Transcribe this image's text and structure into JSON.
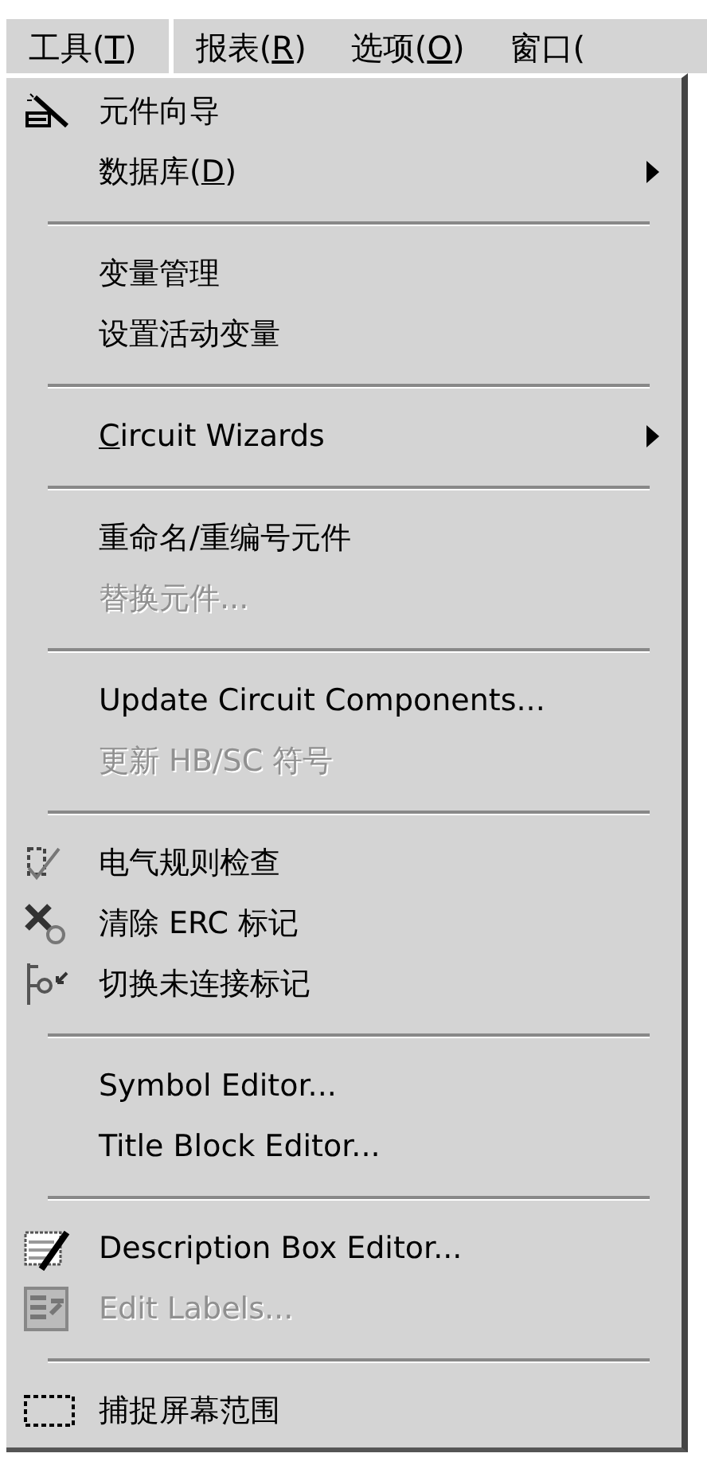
{
  "menu_bar": [
    {
      "before": "工具(",
      "key": "T",
      "after": ")",
      "selected": true
    },
    {
      "before": "报表(",
      "key": "R",
      "after": ")",
      "selected": false
    },
    {
      "before": "选项(",
      "key": "O",
      "after": ")",
      "selected": false
    },
    {
      "before": "窗口(",
      "selected": false
    }
  ],
  "menu": {
    "items": [
      {
        "kind": "item",
        "before": "元件向导",
        "disabled": false
      },
      {
        "kind": "item",
        "before": "数据库(",
        "key": "D",
        "after": ")",
        "submenu": true,
        "disabled": false
      },
      {
        "kind": "separator"
      },
      {
        "kind": "item",
        "before": "变量管理",
        "disabled": false
      },
      {
        "kind": "item",
        "before": "设置活动变量",
        "disabled": false
      },
      {
        "kind": "separator"
      },
      {
        "kind": "item",
        "key": "C",
        "after": "ircuit Wizards",
        "submenu": true,
        "disabled": false
      },
      {
        "kind": "separator"
      },
      {
        "kind": "item",
        "before": "重命名/重编号元件",
        "disabled": false
      },
      {
        "kind": "item",
        "before": "替换元件...",
        "disabled": true
      },
      {
        "kind": "separator"
      },
      {
        "kind": "item",
        "before": "Update Circuit Components...",
        "disabled": false
      },
      {
        "kind": "item",
        "before": "更新 HB/SC 符号",
        "disabled": true
      },
      {
        "kind": "separator"
      },
      {
        "kind": "item",
        "before": "电气规则检查",
        "disabled": false
      },
      {
        "kind": "item",
        "before": "清除 ERC 标记",
        "disabled": false
      },
      {
        "kind": "item",
        "before": "切换未连接标记",
        "disabled": false
      },
      {
        "kind": "separator"
      },
      {
        "kind": "item",
        "before": "Symbol Editor...",
        "disabled": false
      },
      {
        "kind": "item",
        "before": "Title Block Editor...",
        "disabled": false
      },
      {
        "kind": "separator"
      },
      {
        "kind": "item",
        "before": "Description Box Editor...",
        "disabled": false
      },
      {
        "kind": "item",
        "before": "Edit Labels...",
        "disabled": true
      },
      {
        "kind": "separator"
      },
      {
        "kind": "item",
        "before": "捕捉屏幕范围",
        "disabled": false
      }
    ]
  }
}
